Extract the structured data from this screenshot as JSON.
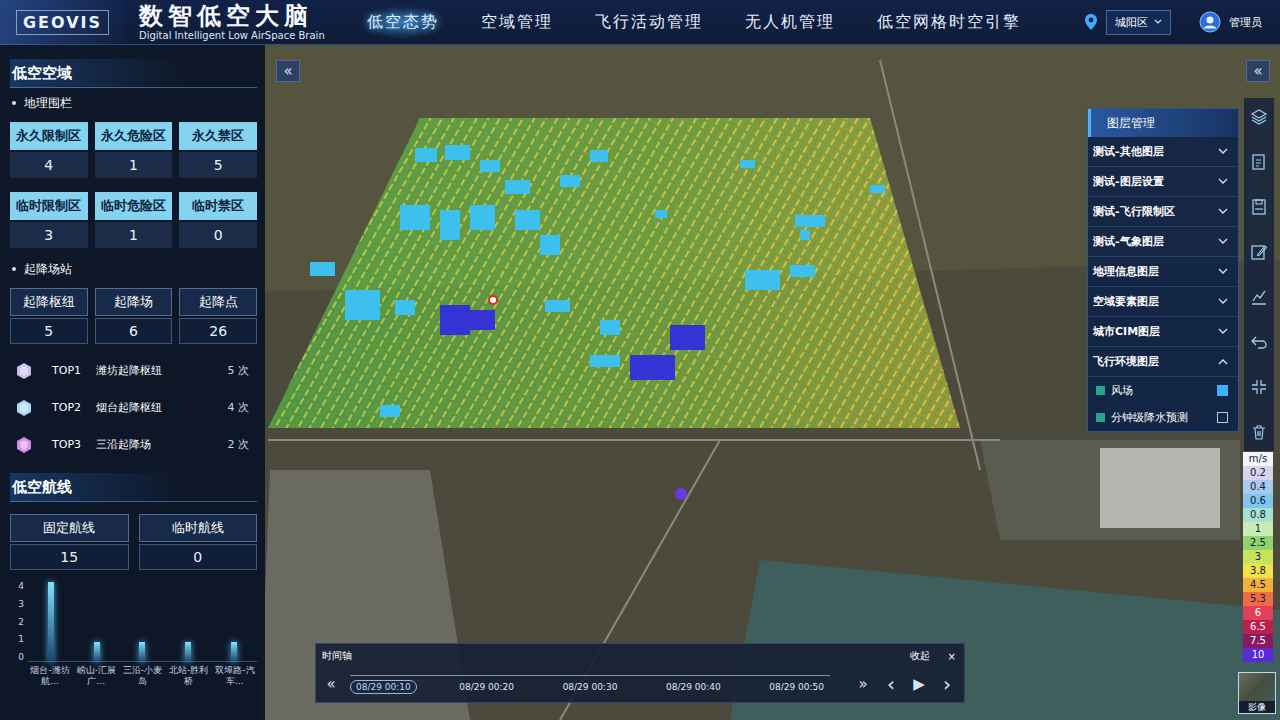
{
  "header": {
    "logo": "GEOVIS",
    "title": "数智低空大脑",
    "subtitle": "Digital Intelligent Low AirSpace Brain",
    "nav": [
      {
        "label": "低空态势",
        "selected": true
      },
      {
        "label": "空域管理",
        "selected": false
      },
      {
        "label": "飞行活动管理",
        "selected": false
      },
      {
        "label": "无人机管理",
        "selected": false
      },
      {
        "label": "低空网格时空引擎",
        "selected": false
      }
    ],
    "region": "城阳区",
    "user": "管理员"
  },
  "airspace": {
    "title": "低空空域",
    "fence_title": "地理围栏",
    "fences": [
      {
        "label": "永久限制区",
        "value": "4"
      },
      {
        "label": "永久危险区",
        "value": "1"
      },
      {
        "label": "永久禁区",
        "value": "5"
      },
      {
        "label": "临时限制区",
        "value": "3"
      },
      {
        "label": "临时危险区",
        "value": "1"
      },
      {
        "label": "临时禁区",
        "value": "0"
      }
    ],
    "site_title": "起降场站",
    "sites": [
      {
        "label": "起降枢纽",
        "value": "5"
      },
      {
        "label": "起降场",
        "value": "6"
      },
      {
        "label": "起降点",
        "value": "26"
      }
    ],
    "top": [
      {
        "rank": "TOP1",
        "name": "潍坊起降枢纽",
        "count": "5 次",
        "color": "#c9c2f2"
      },
      {
        "rank": "TOP2",
        "name": "烟台起降枢纽",
        "count": "4 次",
        "color": "#a9d6f5"
      },
      {
        "rank": "TOP3",
        "name": "三沿起降场",
        "count": "2 次",
        "color": "#d58ce8"
      }
    ]
  },
  "routes": {
    "title": "低空航线",
    "stats": [
      {
        "label": "固定航线",
        "value": "15"
      },
      {
        "label": "临时航线",
        "value": "0"
      }
    ],
    "chart": {
      "y_ticks": [
        "4",
        "3",
        "2",
        "1",
        "0"
      ],
      "max": 4,
      "labels": [
        "烟台-潍坊航...",
        "崂山-汇展广...",
        "三沿-小麦岛",
        "北站-胜利桥",
        "双埠路-汽车..."
      ],
      "values": [
        4,
        1,
        1,
        1,
        1
      ]
    }
  },
  "map": {
    "collapse_left": "«",
    "collapse_right": "«"
  },
  "layers": {
    "title": "图层管理",
    "groups": [
      {
        "label": "测试-其他图层",
        "expanded": false,
        "children": []
      },
      {
        "label": "测试-图层设置",
        "expanded": false,
        "children": []
      },
      {
        "label": "测试-飞行限制区",
        "expanded": false,
        "children": []
      },
      {
        "label": "测试-气象图层",
        "expanded": false,
        "children": []
      },
      {
        "label": "地理信息图层",
        "expanded": false,
        "children": []
      },
      {
        "label": "空域要素图层",
        "expanded": false,
        "children": []
      },
      {
        "label": "城市CIM图层",
        "expanded": false,
        "children": []
      },
      {
        "label": "飞行环境图层",
        "expanded": true,
        "children": [
          {
            "label": "风场",
            "checked": true
          },
          {
            "label": "分钟级降水预测",
            "checked": false
          }
        ]
      }
    ]
  },
  "legend": {
    "unit": "m/s",
    "stops": [
      {
        "value": "0.2",
        "color": "#d9d3ee"
      },
      {
        "value": "0.4",
        "color": "#a9c9ef"
      },
      {
        "value": "0.6",
        "color": "#7fc6e8"
      },
      {
        "value": "0.8",
        "color": "#a8e0d0"
      },
      {
        "value": "1",
        "color": "#c9ecb4"
      },
      {
        "value": "2.5",
        "color": "#8fd36a"
      },
      {
        "value": "3",
        "color": "#c8e25a"
      },
      {
        "value": "3.8",
        "color": "#f0e34a"
      },
      {
        "value": "4.5",
        "color": "#f5b03a"
      },
      {
        "value": "5.3",
        "color": "#ef6a45"
      },
      {
        "value": "6",
        "color": "#e0405a"
      },
      {
        "value": "6.5",
        "color": "#b82050"
      },
      {
        "value": "7.5",
        "color": "#8a1a60"
      },
      {
        "value": "10",
        "color": "#5a2ad8"
      }
    ]
  },
  "timeline": {
    "title": "时间轴",
    "collapse": "收起",
    "close": "×",
    "prev": "«",
    "next": "»",
    "step_back": "‹",
    "play": "▶",
    "step_forward": "›",
    "ticks": [
      {
        "label": "08/29 00:10",
        "selected": true
      },
      {
        "label": "08/29 00:20",
        "selected": false
      },
      {
        "label": "08/29 00:30",
        "selected": false
      },
      {
        "label": "08/29 00:40",
        "selected": false
      },
      {
        "label": "08/29 00:50",
        "selected": false
      }
    ]
  },
  "basemap": {
    "label": "影像"
  }
}
